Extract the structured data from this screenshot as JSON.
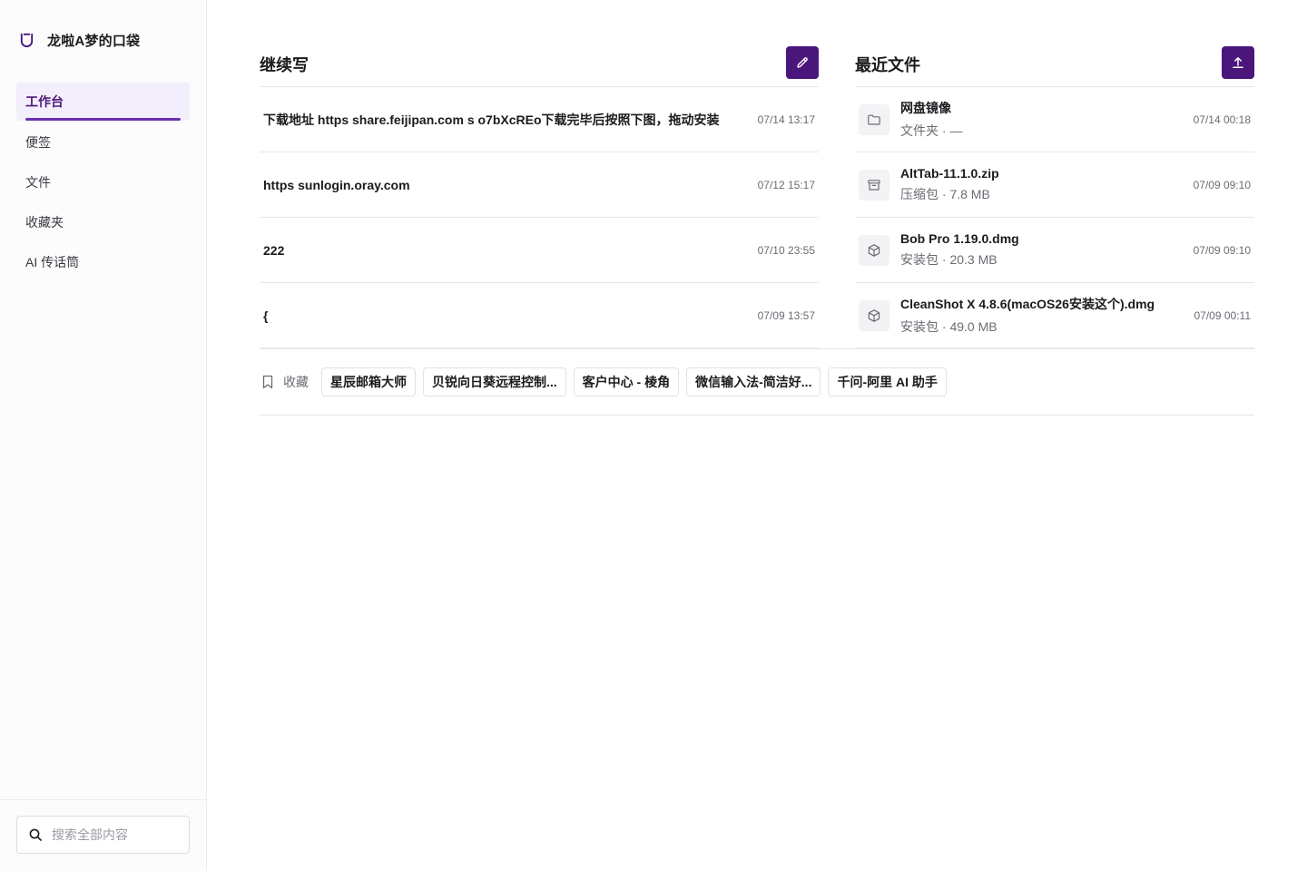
{
  "app": {
    "name": "龙啦A梦的口袋"
  },
  "sidebar": {
    "items": [
      {
        "label": "工作台",
        "active": true
      },
      {
        "label": "便签"
      },
      {
        "label": "文件"
      },
      {
        "label": "收藏夹"
      },
      {
        "label": "AI 传话筒"
      }
    ],
    "search_placeholder": "搜索全部内容"
  },
  "continue_writing": {
    "title": "继续写",
    "action_icon": "pencil-icon",
    "notes": [
      {
        "title": "下载地址 https share.feijipan.com s o7bXcREo下载完毕后按照下图，拖动安装",
        "time": "07/14 13:17"
      },
      {
        "title": "https sunlogin.oray.com",
        "time": "07/12 15:17"
      },
      {
        "title": "222",
        "time": "07/10 23:55"
      },
      {
        "title": "{",
        "time": "07/09 13:57"
      }
    ]
  },
  "recent_files": {
    "title": "最近文件",
    "action_icon": "upload-icon",
    "files": [
      {
        "name": "网盘镜像",
        "meta": "文件夹 · —",
        "time": "07/14 00:18",
        "icon": "folder-icon"
      },
      {
        "name": "AltTab-11.1.0.zip",
        "meta": "压缩包 · 7.8 MB",
        "time": "07/09 09:10",
        "icon": "archive-icon"
      },
      {
        "name": "Bob Pro 1.19.0.dmg",
        "meta": "安装包 · 20.3 MB",
        "time": "07/09 09:10",
        "icon": "package-icon"
      },
      {
        "name": "CleanShot X 4.8.6(macOS26安装这个).dmg",
        "meta": "安装包 · 49.0 MB",
        "time": "07/09 00:11",
        "icon": "package-icon"
      }
    ]
  },
  "bookmarks": {
    "label": "收藏",
    "items": [
      "星辰邮箱大师",
      "贝锐向日葵远程控制...",
      "客户中心 - 棱角",
      "微信输入法-简洁好...",
      "千问-阿里 AI 助手"
    ]
  },
  "colors": {
    "accent": "#4b167c",
    "accent_bright": "#6a2fb0",
    "active_bg": "#f2eefb"
  }
}
